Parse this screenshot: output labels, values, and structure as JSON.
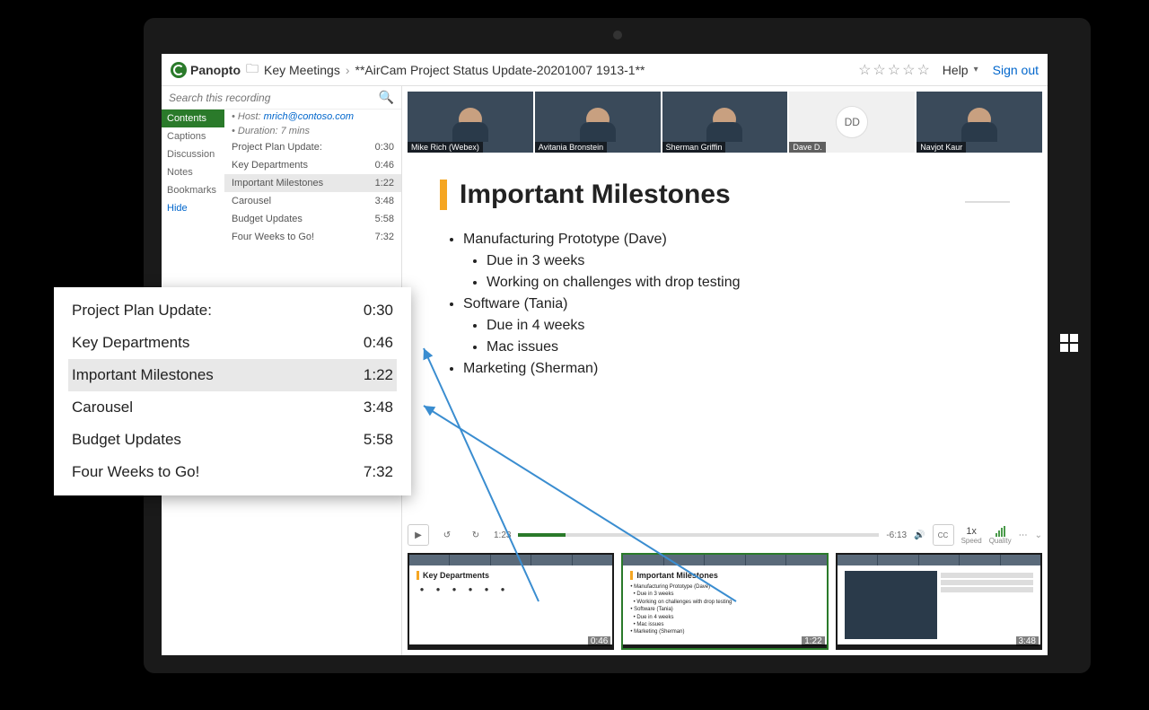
{
  "header": {
    "brand": "Panopto",
    "folder": "Key Meetings",
    "title": "**AirCam Project Status Update-20201007 1913-1**",
    "help": "Help",
    "signout": "Sign out"
  },
  "search": {
    "placeholder": "Search this recording"
  },
  "tabs": [
    "Contents",
    "Captions",
    "Discussion",
    "Notes",
    "Bookmarks",
    "Hide"
  ],
  "meta": {
    "host_label": "Host:",
    "host_email": "mrich@contoso.com",
    "duration_label": "Duration:",
    "duration": "7 mins"
  },
  "toc": [
    {
      "label": "Project Plan Update:",
      "time": "0:30"
    },
    {
      "label": "Key Departments",
      "time": "0:46"
    },
    {
      "label": "Important Milestones",
      "time": "1:22"
    },
    {
      "label": "Carousel",
      "time": "3:48"
    },
    {
      "label": "Budget Updates",
      "time": "5:58"
    },
    {
      "label": "Four Weeks to Go!",
      "time": "7:32"
    }
  ],
  "participants": [
    {
      "name": "Mike Rich (Webex)"
    },
    {
      "name": "Avitania Bronstein"
    },
    {
      "name": "Sherman Griffin"
    },
    {
      "name": "Dave D.",
      "initials": "DD",
      "avatar": true
    },
    {
      "name": "Navjot Kaur"
    }
  ],
  "slide": {
    "title": "Important Milestones",
    "b1": "Manufacturing Prototype (Dave)",
    "b1a": "Due in 3 weeks",
    "b1b": "Working on challenges with drop testing",
    "b2": "Software (Tania)",
    "b2a": "Due in 4 weeks",
    "b2b": "Mac issues",
    "b3": "Marketing (Sherman)"
  },
  "player": {
    "current": "1:23",
    "remaining": "-6:13",
    "speed": "1x",
    "speed_label": "Speed",
    "quality_label": "Quality",
    "cc": "CC"
  },
  "thumbs": [
    {
      "title": "Key Departments",
      "time": "0:46"
    },
    {
      "title": "Important Milestones",
      "time": "1:22"
    },
    {
      "title": "",
      "time": "3:48"
    }
  ]
}
